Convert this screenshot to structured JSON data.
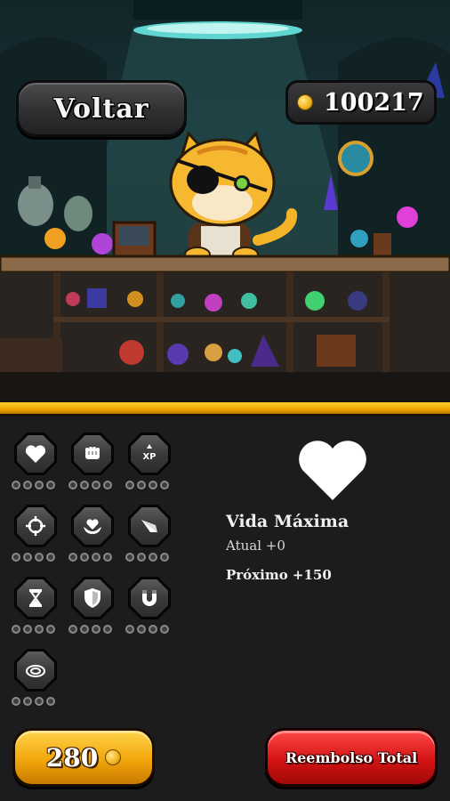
{
  "header": {
    "back_label": "Voltar",
    "coins": "100217"
  },
  "upgrades": [
    {
      "icon": "heart-icon",
      "level": 0,
      "max": 4
    },
    {
      "icon": "fist-icon",
      "level": 0,
      "max": 4
    },
    {
      "icon": "xp-icon",
      "icon_text": "XP",
      "level": 0,
      "max": 4
    },
    {
      "icon": "crosshair-icon",
      "level": 0,
      "max": 4
    },
    {
      "icon": "heart-hands-icon",
      "level": 0,
      "max": 4
    },
    {
      "icon": "dash-icon",
      "level": 0,
      "max": 4
    },
    {
      "icon": "hourglass-icon",
      "level": 0,
      "max": 4
    },
    {
      "icon": "shield-icon",
      "level": 0,
      "max": 4
    },
    {
      "icon": "magnet-icon",
      "level": 0,
      "max": 4
    },
    {
      "icon": "area-icon",
      "level": 0,
      "max": 4
    }
  ],
  "detail": {
    "icon": "heart-icon",
    "title": "Vida Máxima",
    "current": "Atual +0",
    "next": "Próximo +150"
  },
  "footer": {
    "buy_price": "280",
    "refund_label": "Reembolso Total"
  },
  "colors": {
    "gold": "#f0a800",
    "refund_red": "#d41414",
    "panel_bg": "#1c1c1e"
  }
}
